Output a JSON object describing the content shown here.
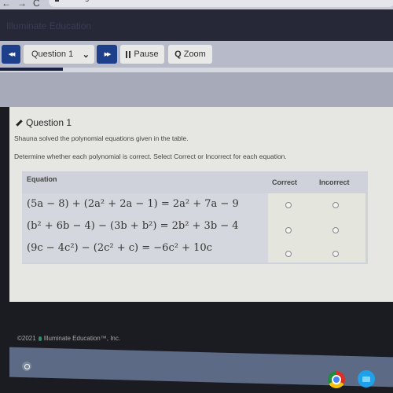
{
  "browser": {
    "back_glyph": "←",
    "forward_glyph": "→",
    "reload_glyph": "C",
    "url": "testing.illuminated..."
  },
  "app_header": {
    "title": "Illuminate Education"
  },
  "toolbar": {
    "prev_icon": "double-chevron-left",
    "prev_glyph": "◀◀",
    "question_select_value": "Question 1",
    "select_caret": "⌄",
    "next_icon": "double-chevron-right",
    "next_glyph": "▶▶",
    "pause_label": "Pause",
    "zoom_label": "Zoom",
    "zoom_glyph": "Q"
  },
  "progress": {
    "percent": 16
  },
  "question": {
    "heading": "Question 1",
    "intro": "Shauna solved the polynomial equations given in the table.",
    "instruction": "Determine whether each polynomial is correct. Select Correct or Incorrect for each equation.",
    "table": {
      "headers": [
        "Equation",
        "Correct",
        "Incorrect"
      ],
      "rows": [
        {
          "equation": "(5a − 8) + (2a² + 2a − 1) = 2a² + 7a − 9",
          "correct_selected": false,
          "incorrect_selected": false
        },
        {
          "equation": "(b² + 6b − 4) − (3b + b²) = 2b² + 3b − 4",
          "correct_selected": false,
          "incorrect_selected": false
        },
        {
          "equation": "(9c − 4c²) − (2c² + c) = −6c² + 10c",
          "correct_selected": false,
          "incorrect_selected": false
        }
      ]
    }
  },
  "footer": {
    "copyright": "©2021",
    "company": "Illuminate Education™, Inc."
  },
  "shelf": {
    "apps": [
      "launcher",
      "chrome",
      "files"
    ]
  },
  "colors": {
    "nav_button": "#1e3f8a",
    "app_header": "#262838",
    "toolbar": "#b7bac8",
    "content_bg": "#e6e7e2"
  }
}
